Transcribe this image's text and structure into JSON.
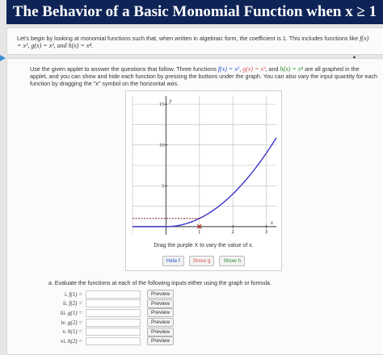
{
  "header": {
    "title": "The Behavior of a Basic Monomial Function when x ≥ 1"
  },
  "intro": {
    "text_before": "Let's begin by looking at monomial functions such that, when written in algebraic form, the coefficient is 1. This includes functions like ",
    "functions": "f(x) = x², g(x) = x³, and h(x) = x⁴."
  },
  "instructions": {
    "part1": "Use the given applet to answer the questions that follow. Three functions ",
    "f_def": "f(x) = x²",
    "g_def": "g(x) = x³",
    "and": ", and ",
    "h_def": "h(x) = x⁴",
    "part2": " are all graphed in the applet, and you can show and hide each function by pressing the buttons under the graph. You can also vary the input quantity for each function by dragging the \"x\" symbol on the horizontal axis."
  },
  "applet": {
    "y_axis_label": "y",
    "x_axis_label": "x",
    "y_ticks": [
      "15",
      "10",
      "5"
    ],
    "x_ticks": [
      "1",
      "2",
      "3"
    ],
    "hint": "Drag the purple X to vary the value of x.",
    "buttons": {
      "hide_f": "Hide f",
      "show_g": "Show g",
      "show_h": "Show h"
    }
  },
  "chart_data": {
    "type": "line",
    "xlim": [
      -1,
      3.3
    ],
    "ylim": [
      -1,
      16
    ],
    "grid": true,
    "series": [
      {
        "name": "f",
        "function": "x^2",
        "color": "#3a34c8"
      }
    ],
    "marker_x": 1,
    "marker_y": 1
  },
  "part_a": {
    "prompt": "a. Evaluate the functions at each of the following inputs either using the graph or formula.",
    "preview_label": "Preview",
    "rows": [
      {
        "numeral": "i.",
        "expr": "f(1) =",
        "value": ""
      },
      {
        "numeral": "ii.",
        "expr": "f(2) =",
        "value": ""
      },
      {
        "numeral": "iii.",
        "expr": "g(1) =",
        "value": ""
      },
      {
        "numeral": "iv.",
        "expr": "g(2) =",
        "value": ""
      },
      {
        "numeral": "v.",
        "expr": "h(1) =",
        "value": ""
      },
      {
        "numeral": "vi.",
        "expr": "h(2) =",
        "value": ""
      }
    ]
  },
  "colors": {
    "title_bg": "#0f2456",
    "curve": "#3a34c8",
    "marker": "#c0392b"
  }
}
